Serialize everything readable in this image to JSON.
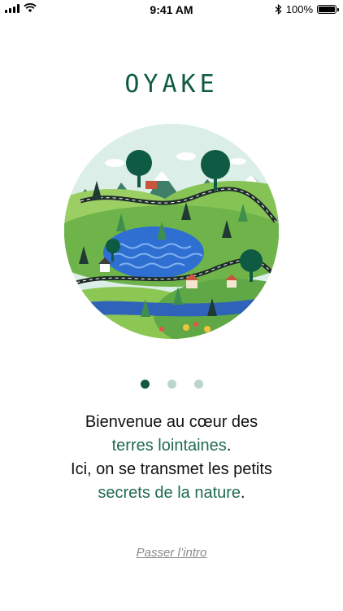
{
  "status_bar": {
    "time": "9:41 AM",
    "battery_text": "100%",
    "icons": [
      "signal-icon",
      "wifi-icon",
      "bluetooth-icon",
      "battery-icon"
    ]
  },
  "app": {
    "logo_text": "OYAKE"
  },
  "illustration": {
    "subject": "landscape-illustration",
    "colors": {
      "sky": "#dbeee8",
      "grass": "#7cc04c",
      "water": "#2f6fd2",
      "tree": "#0f5a43"
    }
  },
  "pager": {
    "count": 3,
    "active_index": 0
  },
  "intro": {
    "line1": "Bienvenue au cœur des",
    "line2_highlight": "terres lointaines",
    "line2_suffix": ".",
    "line3": "Ici, on se transmet les petits",
    "line4_highlight": "secrets de la nature",
    "line4_suffix": "."
  },
  "actions": {
    "skip_label": "Passer l’intro"
  },
  "theme": {
    "brand_color": "#0f5a43",
    "accent_text_color": "#1f6a51",
    "dot_inactive": "#b9d6cd"
  }
}
